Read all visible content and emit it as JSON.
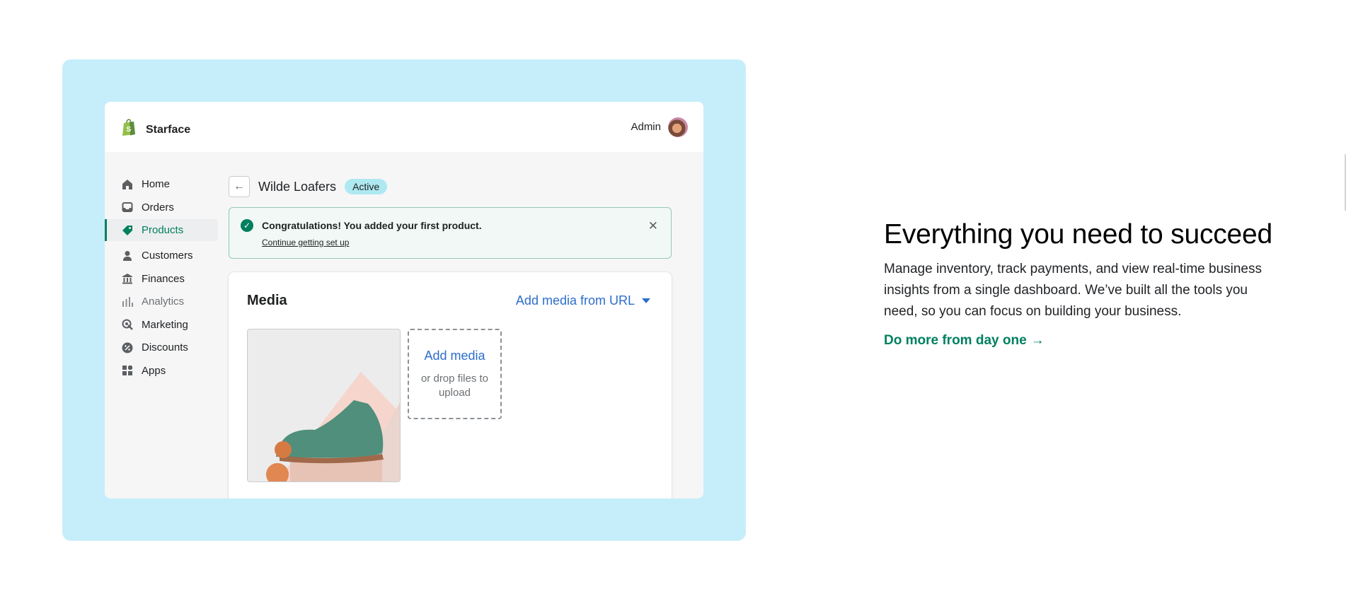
{
  "app": {
    "store_name": "Starface",
    "admin_label": "Admin",
    "logo_icon": "shopify-bag-icon",
    "avatar_icon": "user-avatar"
  },
  "sidebar": {
    "items": [
      {
        "label": "Home",
        "icon": "home-icon"
      },
      {
        "label": "Orders",
        "icon": "inbox-icon"
      },
      {
        "label": "Products",
        "icon": "tag-icon",
        "active": true
      },
      {
        "label": "Customers",
        "icon": "person-icon"
      },
      {
        "label": "Finances",
        "icon": "bank-icon"
      },
      {
        "label": "Analytics",
        "icon": "bar-chart-icon"
      },
      {
        "label": "Marketing",
        "icon": "target-icon"
      },
      {
        "label": "Discounts",
        "icon": "discount-icon"
      },
      {
        "label": "Apps",
        "icon": "apps-icon"
      }
    ]
  },
  "product": {
    "title": "Wilde Loafers",
    "status": "Active"
  },
  "banner": {
    "title": "Congratulations! You added your first product.",
    "link": "Continue getting set up"
  },
  "media": {
    "title": "Media",
    "add_url_label": "Add media from URL",
    "dropzone_title": "Add media",
    "dropzone_subtitle": "or drop files to upload"
  },
  "marketing": {
    "headline": "Everything you need to succeed",
    "body": "Manage inventory, track payments, and view real-time business insights from a single dashboard. We’ve built all the tools you need, so you can focus on building your business.",
    "cta_label": "Do more from day one",
    "cta_arrow": "→"
  },
  "colors": {
    "showcase_bg": "#c6eefa",
    "brand_green": "#008060",
    "link_blue": "#2c6ecb",
    "badge_bg": "#aee9f1"
  }
}
